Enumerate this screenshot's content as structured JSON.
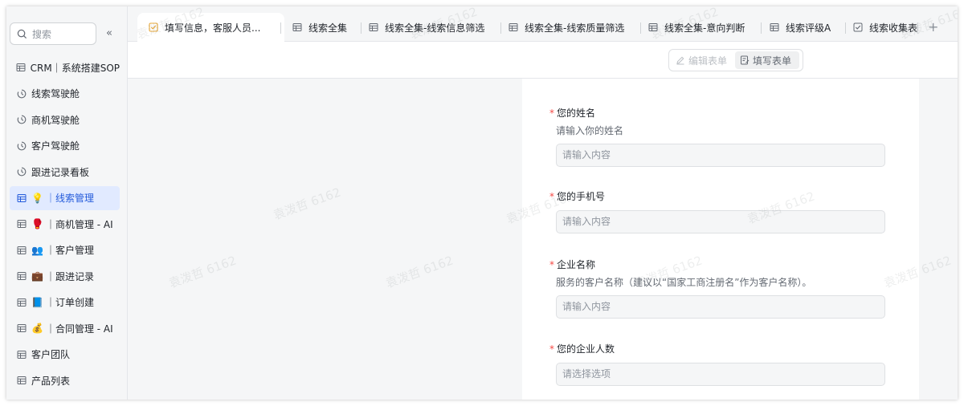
{
  "sidebar": {
    "search_placeholder": "搜索",
    "collapse_glyph": "«",
    "items": [
      {
        "icon": "table-icon",
        "emoji": "",
        "label": "CRM｜系统搭建SOP",
        "active": false
      },
      {
        "icon": "dashboard-icon",
        "emoji": "",
        "label": "线索驾驶舱",
        "active": false
      },
      {
        "icon": "dashboard-icon",
        "emoji": "",
        "label": "商机驾驶舱",
        "active": false
      },
      {
        "icon": "dashboard-icon",
        "emoji": "",
        "label": "客户驾驶舱",
        "active": false
      },
      {
        "icon": "dashboard-icon",
        "emoji": "",
        "label": "跟进记录看板",
        "active": false
      },
      {
        "icon": "table-icon",
        "emoji": "💡",
        "label": "｜线索管理",
        "active": true
      },
      {
        "icon": "table-icon",
        "emoji": "🥊",
        "label": "｜商机管理 - AI",
        "active": false
      },
      {
        "icon": "table-icon",
        "emoji": "👥",
        "label": "｜客户管理",
        "active": false
      },
      {
        "icon": "table-icon",
        "emoji": "💼",
        "label": "｜跟进记录",
        "active": false
      },
      {
        "icon": "table-icon",
        "emoji": "📘",
        "label": "｜订单创建",
        "active": false
      },
      {
        "icon": "table-icon",
        "emoji": "💰",
        "label": "｜合同管理 - AI",
        "active": false
      },
      {
        "icon": "table-icon",
        "emoji": "",
        "label": "客户团队",
        "active": false
      },
      {
        "icon": "table-icon",
        "emoji": "",
        "label": "产品列表",
        "active": false
      }
    ]
  },
  "tabs": [
    {
      "icon": "form-check-icon",
      "label": "填写信息，客服人员...",
      "active": true
    },
    {
      "icon": "grid-icon",
      "label": "线索全集",
      "active": false
    },
    {
      "icon": "grid-icon",
      "label": "线索全集-线索信息筛选",
      "active": false
    },
    {
      "icon": "grid-icon",
      "label": "线索全集-线索质量筛选",
      "active": false
    },
    {
      "icon": "grid-icon",
      "label": "线索全集-意向判断",
      "active": false
    },
    {
      "icon": "grid-icon",
      "label": "线索评级A",
      "active": false
    },
    {
      "icon": "form-check-icon",
      "label": "线索收集表",
      "active": false
    }
  ],
  "add_tab_glyph": "+",
  "toolbar": {
    "edit_label": "编辑表单",
    "fill_label": "填写表单"
  },
  "form": {
    "fields": [
      {
        "required": true,
        "label": "您的姓名",
        "description": "请输入你的姓名",
        "placeholder": "请输入内容"
      },
      {
        "required": true,
        "label": "您的手机号",
        "description": "",
        "placeholder": "请输入内容"
      },
      {
        "required": true,
        "label": "企业名称",
        "description": "服务的客户名称（建议以“国家工商注册名”作为客户名称）。",
        "placeholder": "请输入内容"
      },
      {
        "required": true,
        "label": "您的企业人数",
        "description": "",
        "placeholder": "请选择选项"
      }
    ],
    "required_mark": "*"
  },
  "watermark": "袁泼哲 6162",
  "colors": {
    "accent": "#245bdb",
    "active_bg": "#e1eaff",
    "required": "#f54a45"
  }
}
